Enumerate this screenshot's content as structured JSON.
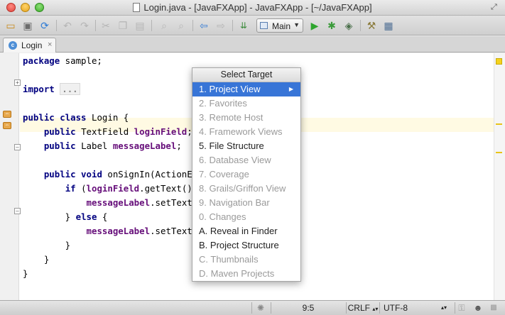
{
  "window": {
    "title": "Login.java - [JavaFXApp] - JavaFXApp - [~/JavaFXApp]"
  },
  "toolbar": {
    "icons": [
      "open-folder-icon",
      "save-icon",
      "sync-icon",
      "undo-icon",
      "redo-icon",
      "cut-icon",
      "copy-icon",
      "paste-icon",
      "find-icon",
      "replace-icon",
      "back-icon",
      "forward-icon",
      "make-project-icon",
      "run-config-icon",
      "run-icon",
      "debug-icon",
      "coverage-icon",
      "settings-icon",
      "project-structure-icon"
    ],
    "run_config": "Main"
  },
  "tabs": [
    {
      "label": "Login",
      "close": "×",
      "icon_letter": "c"
    }
  ],
  "editor": {
    "lines": [
      {
        "parts": [
          {
            "t": "package",
            "c": "kw"
          },
          {
            "t": " sample;"
          }
        ]
      },
      {
        "parts": []
      },
      {
        "parts": [
          {
            "t": "import",
            "c": "kw"
          },
          {
            "t": " "
          },
          {
            "t": "...",
            "c": "fold-collapsed"
          }
        ]
      },
      {
        "parts": []
      },
      {
        "parts": [
          {
            "t": "public class",
            "c": "kw"
          },
          {
            "t": " Login {"
          }
        ]
      },
      {
        "parts": [
          {
            "t": "    "
          },
          {
            "t": "public",
            "c": "kw"
          },
          {
            "t": " TextField "
          },
          {
            "t": "loginField",
            "c": "fld"
          },
          {
            "t": ";"
          }
        ]
      },
      {
        "parts": [
          {
            "t": "    "
          },
          {
            "t": "public",
            "c": "kw"
          },
          {
            "t": " Label "
          },
          {
            "t": "messageLabel",
            "c": "fld"
          },
          {
            "t": ";"
          }
        ]
      },
      {
        "parts": []
      },
      {
        "parts": [
          {
            "t": "    "
          },
          {
            "t": "public void",
            "c": "kw"
          },
          {
            "t": " onSignIn(ActionEve"
          }
        ]
      },
      {
        "parts": [
          {
            "t": "        "
          },
          {
            "t": "if",
            "c": "kw"
          },
          {
            "t": " ("
          },
          {
            "t": "loginField",
            "c": "fld"
          },
          {
            "t": ".getText().i"
          }
        ]
      },
      {
        "parts": [
          {
            "t": "            "
          },
          {
            "t": "messageLabel",
            "c": "fld"
          },
          {
            "t": ".setText("
          },
          {
            "t": "\"",
            "c": "str"
          }
        ]
      },
      {
        "parts": [
          {
            "t": "        } "
          },
          {
            "t": "else",
            "c": "kw"
          },
          {
            "t": " {"
          }
        ]
      },
      {
        "parts": [
          {
            "t": "            "
          },
          {
            "t": "messageLabel",
            "c": "fld"
          },
          {
            "t": ".setText("
          },
          {
            "t": "\"",
            "c": "str"
          }
        ]
      },
      {
        "parts": [
          {
            "t": "        }"
          }
        ]
      },
      {
        "parts": [
          {
            "t": "    }"
          }
        ]
      },
      {
        "parts": [
          {
            "t": "}"
          }
        ]
      }
    ]
  },
  "popup": {
    "title": "Select Target",
    "items": [
      {
        "label": "1. Project View",
        "enabled": true,
        "selected": true,
        "submenu": true
      },
      {
        "label": "2. Favorites",
        "enabled": false
      },
      {
        "label": "3. Remote Host",
        "enabled": false
      },
      {
        "label": "4. Framework Views",
        "enabled": false
      },
      {
        "label": "5. File Structure",
        "enabled": true
      },
      {
        "label": "6. Database View",
        "enabled": false
      },
      {
        "label": "7. Coverage",
        "enabled": false
      },
      {
        "label": "8. Grails/Griffon View",
        "enabled": false
      },
      {
        "label": "9. Navigation Bar",
        "enabled": false
      },
      {
        "label": "0. Changes",
        "enabled": false
      },
      {
        "label": "A. Reveal in Finder",
        "enabled": true
      },
      {
        "label": "B. Project Structure",
        "enabled": true
      },
      {
        "label": "C. Thumbnails",
        "enabled": false
      },
      {
        "label": "D. Maven Projects",
        "enabled": false
      }
    ]
  },
  "statusbar": {
    "position": "9:5",
    "line_separator": "CRLF",
    "encoding": "UTF-8"
  },
  "colors": {
    "selection": "#3875d7",
    "keyword": "#000080",
    "field": "#660e7a",
    "string": "#008000",
    "caret_row": "#fffae3"
  }
}
